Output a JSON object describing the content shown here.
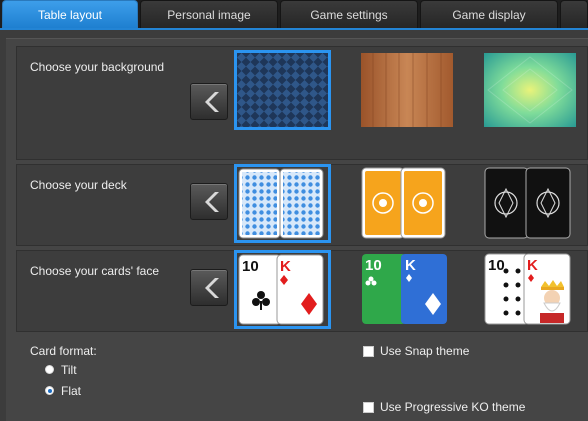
{
  "tabs": [
    {
      "label": "Table layout",
      "active": true
    },
    {
      "label": "Personal image",
      "active": false
    },
    {
      "label": "Game settings",
      "active": false
    },
    {
      "label": "Game display",
      "active": false
    }
  ],
  "rows": {
    "background": {
      "label": "Choose your background"
    },
    "deck": {
      "label": "Choose your deck"
    },
    "face": {
      "label": "Choose your cards' face"
    }
  },
  "card_faces": {
    "ten": "10",
    "king": "K"
  },
  "card_format": {
    "label": "Card format:",
    "options": [
      {
        "label": "Tilt",
        "checked": false
      },
      {
        "label": "Flat",
        "checked": true
      }
    ]
  },
  "checkboxes": {
    "snap": {
      "label": "Use Snap theme",
      "checked": false
    },
    "progressive_ko": {
      "label": "Use Progressive KO theme",
      "checked": false
    }
  },
  "colors": {
    "accent": "#2b94f0",
    "panel": "#3d3d3d",
    "background": "#454545"
  }
}
